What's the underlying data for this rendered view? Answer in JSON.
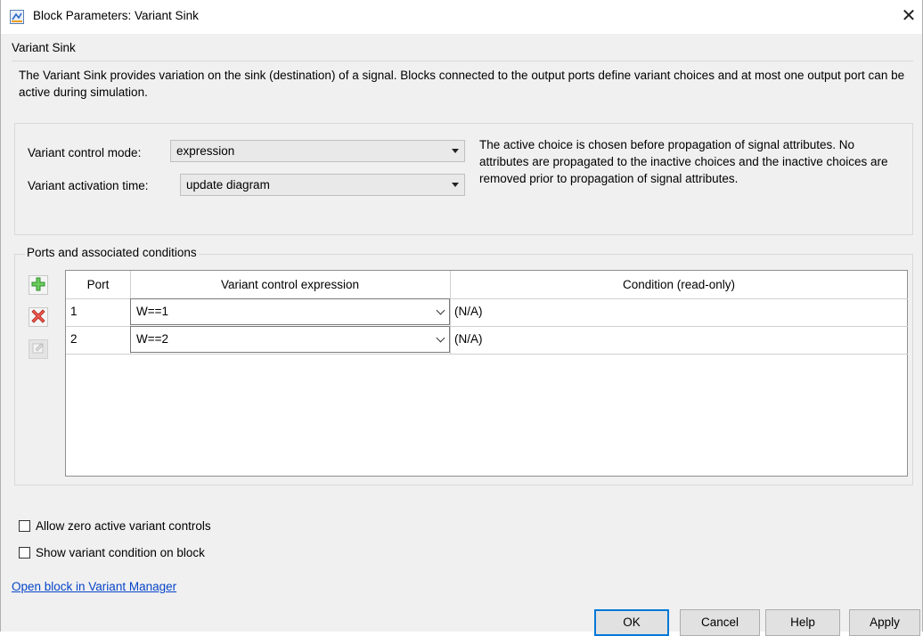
{
  "window": {
    "title": "Block Parameters: Variant Sink",
    "close_glyph": "✕"
  },
  "section_title": "Variant Sink",
  "description": "The Variant Sink provides variation on the sink (destination) of a signal. Blocks connected to the output ports define variant choices and at most one output port can be active during simulation.",
  "params": {
    "control_mode_label": "Variant control mode:",
    "control_mode_value": "expression",
    "activation_time_label": "Variant activation time:",
    "activation_time_value": "update diagram",
    "note": "The active choice is chosen before propagation of signal attributes. No attributes are propagated to the inactive choices and the inactive choices are removed prior to propagation of signal attributes."
  },
  "ports": {
    "group_label": "Ports and associated conditions",
    "columns": [
      "Port",
      "Variant control expression",
      "Condition (read-only)"
    ],
    "rows": [
      {
        "port": "1",
        "expression": "W==1",
        "condition": "(N/A)"
      },
      {
        "port": "2",
        "expression": "W==2",
        "condition": "(N/A)"
      }
    ],
    "tools": [
      "add-icon",
      "delete-icon",
      "edit-icon"
    ]
  },
  "options": {
    "allow_zero_label": "Allow zero active variant controls",
    "show_condition_label": "Show variant condition on block"
  },
  "link_label": "Open block in Variant Manager",
  "buttons": {
    "ok": "OK",
    "cancel": "Cancel",
    "help": "Help",
    "apply": "Apply"
  },
  "colors": {
    "link": "#0645c8",
    "default_button_border": "#0078d7",
    "add_icon": "#3aa83a",
    "delete_icon": "#d9342b"
  }
}
